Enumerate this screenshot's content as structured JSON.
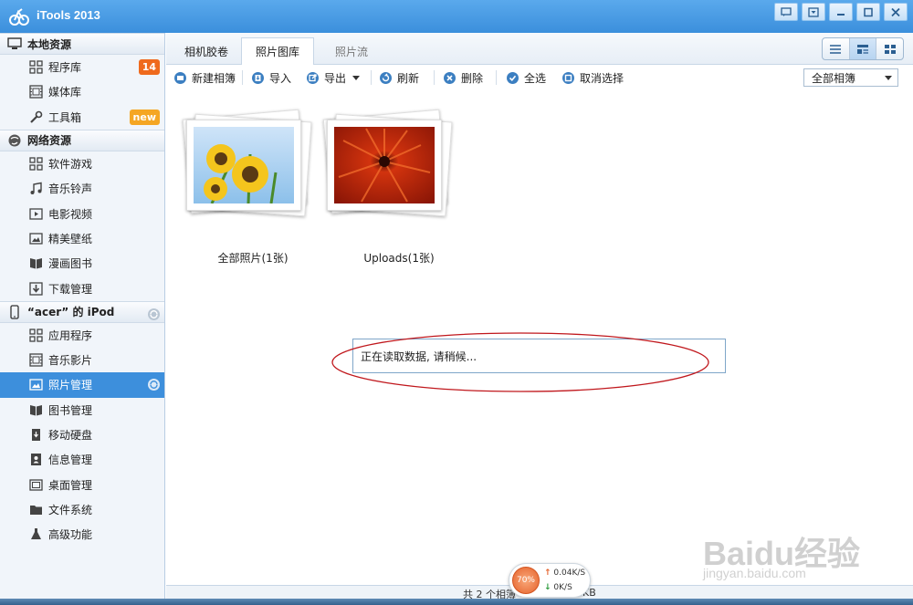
{
  "window": {
    "title": "iTools 2013"
  },
  "sidebar": {
    "sections": [
      {
        "label": "本地资源",
        "items": [
          {
            "label": "程序库",
            "badge": "14"
          },
          {
            "label": "媒体库"
          },
          {
            "label": "工具箱",
            "badge": "new"
          }
        ]
      },
      {
        "label": "网络资源",
        "items": [
          {
            "label": "软件游戏"
          },
          {
            "label": "音乐铃声"
          },
          {
            "label": "电影视频"
          },
          {
            "label": "精美壁纸"
          },
          {
            "label": "漫画图书"
          },
          {
            "label": "下载管理"
          }
        ]
      },
      {
        "label": "“acer” 的 iPod",
        "items": [
          {
            "label": "应用程序"
          },
          {
            "label": "音乐影片"
          },
          {
            "label": "照片管理",
            "active": true
          },
          {
            "label": "图书管理"
          },
          {
            "label": "移动硬盘"
          },
          {
            "label": "信息管理"
          },
          {
            "label": "桌面管理"
          },
          {
            "label": "文件系统"
          },
          {
            "label": "高级功能"
          }
        ]
      }
    ]
  },
  "tabs": [
    {
      "label": "相机胶卷"
    },
    {
      "label": "照片图库",
      "active": true
    },
    {
      "label": "照片流"
    }
  ],
  "toolbar": {
    "new_album": "新建相簿",
    "import": "导入",
    "export": "导出",
    "refresh": "刷新",
    "delete": "删除",
    "select_all": "全选",
    "deselect": "取消选择",
    "album_filter": "全部相簿"
  },
  "albums": [
    {
      "label": "全部照片(1张)"
    },
    {
      "label": "Uploads(1张)"
    }
  ],
  "loading_text": "正在读取数据, 请稍候...",
  "status": {
    "text": "共 2 个相簿",
    "size": "KB",
    "percent": "70%",
    "upload": "0.04K/S",
    "download": "0K/S"
  },
  "watermark": {
    "brand": "Baidu经验",
    "url": "jingyan.baidu.com"
  },
  "colors": {
    "accent": "#3d8fdc",
    "badge": "#ef6a1d",
    "badge_new": "#f5a623"
  }
}
